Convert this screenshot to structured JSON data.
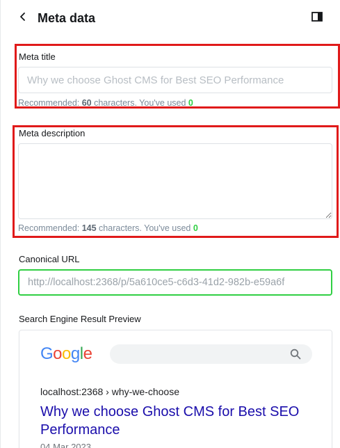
{
  "header": {
    "back_icon": "chevron-left-icon",
    "title": "Meta data",
    "panel_icon": "sidebar-toggle-icon"
  },
  "meta_title": {
    "label": "Meta title",
    "value": "",
    "placeholder": "Why we choose Ghost CMS for Best SEO Performance",
    "hint_prefix": "Recommended: ",
    "hint_count": "60",
    "hint_mid": " characters. You've used ",
    "hint_used": "0"
  },
  "meta_description": {
    "label": "Meta description",
    "value": "",
    "hint_prefix": "Recommended: ",
    "hint_count": "145",
    "hint_mid": " characters. You've used ",
    "hint_used": "0"
  },
  "canonical_url": {
    "label": "Canonical URL",
    "value": "",
    "placeholder": "http://localhost:2368/p/5a610ce5-c6d3-41d2-982b-e59a6f"
  },
  "serp_preview": {
    "label": "Search Engine Result Preview",
    "logo_letters": [
      "G",
      "o",
      "o",
      "g",
      "l",
      "e"
    ],
    "logo_colors": [
      "#4285f4",
      "#ea4335",
      "#fbbc05",
      "#4285f4",
      "#34a853",
      "#ea4335"
    ],
    "search_icon": "search-icon",
    "url": "localhost:2368 › why-we-choose",
    "title": "Why we choose Ghost CMS for Best SEO Performance",
    "date": "04 Mar 2023"
  },
  "colors": {
    "highlight_border": "#e01a1a",
    "focus_border": "#30cf43",
    "count_used": "#30cf43",
    "serp_title": "#1a0dab"
  }
}
